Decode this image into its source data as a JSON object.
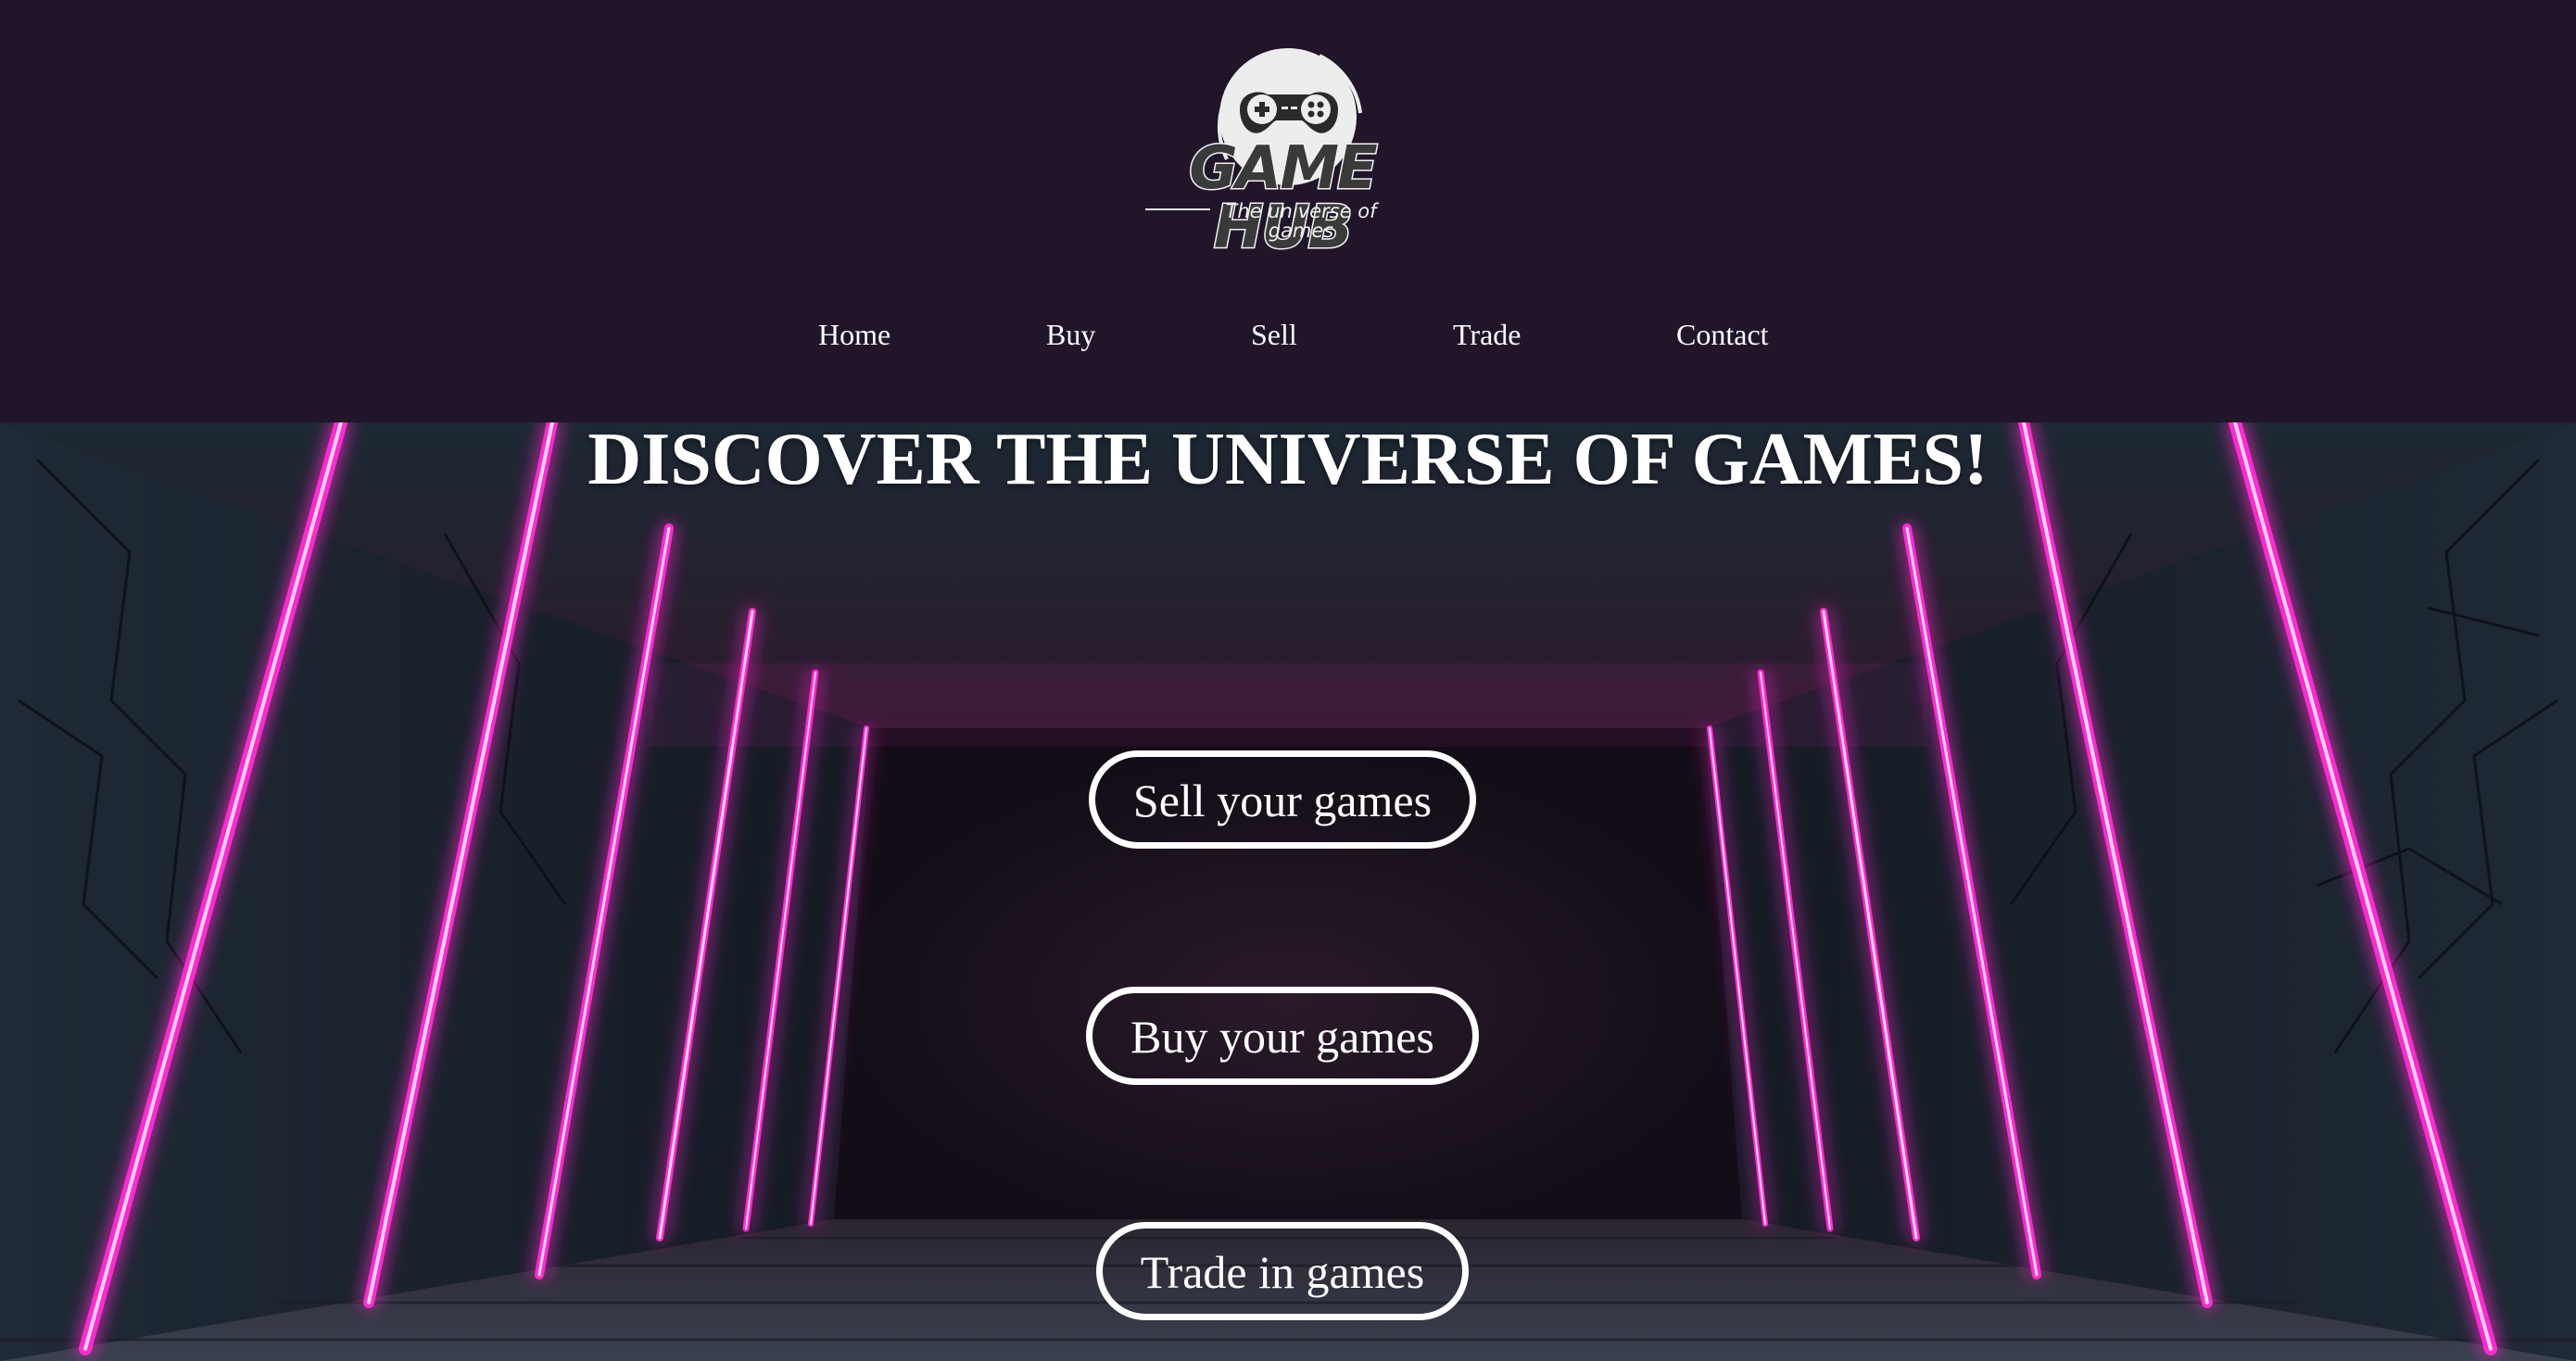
{
  "brand": {
    "name": "GAME HUB",
    "tagline": "The universe of games"
  },
  "nav": {
    "items": [
      {
        "label": "Home"
      },
      {
        "label": "Buy"
      },
      {
        "label": "Sell"
      },
      {
        "label": "Trade"
      },
      {
        "label": "Contact"
      }
    ]
  },
  "hero": {
    "headline": "DISCOVER THE UNIVERSE OF GAMES!",
    "buttons": [
      {
        "label": "Sell your games"
      },
      {
        "label": "Buy your games"
      },
      {
        "label": "Trade in games"
      }
    ]
  },
  "colors": {
    "header_bg": "#21152a",
    "neon_pink": "#ff2ad0",
    "text": "#ffffff"
  },
  "icons": {
    "logo": "gamepad-icon"
  }
}
